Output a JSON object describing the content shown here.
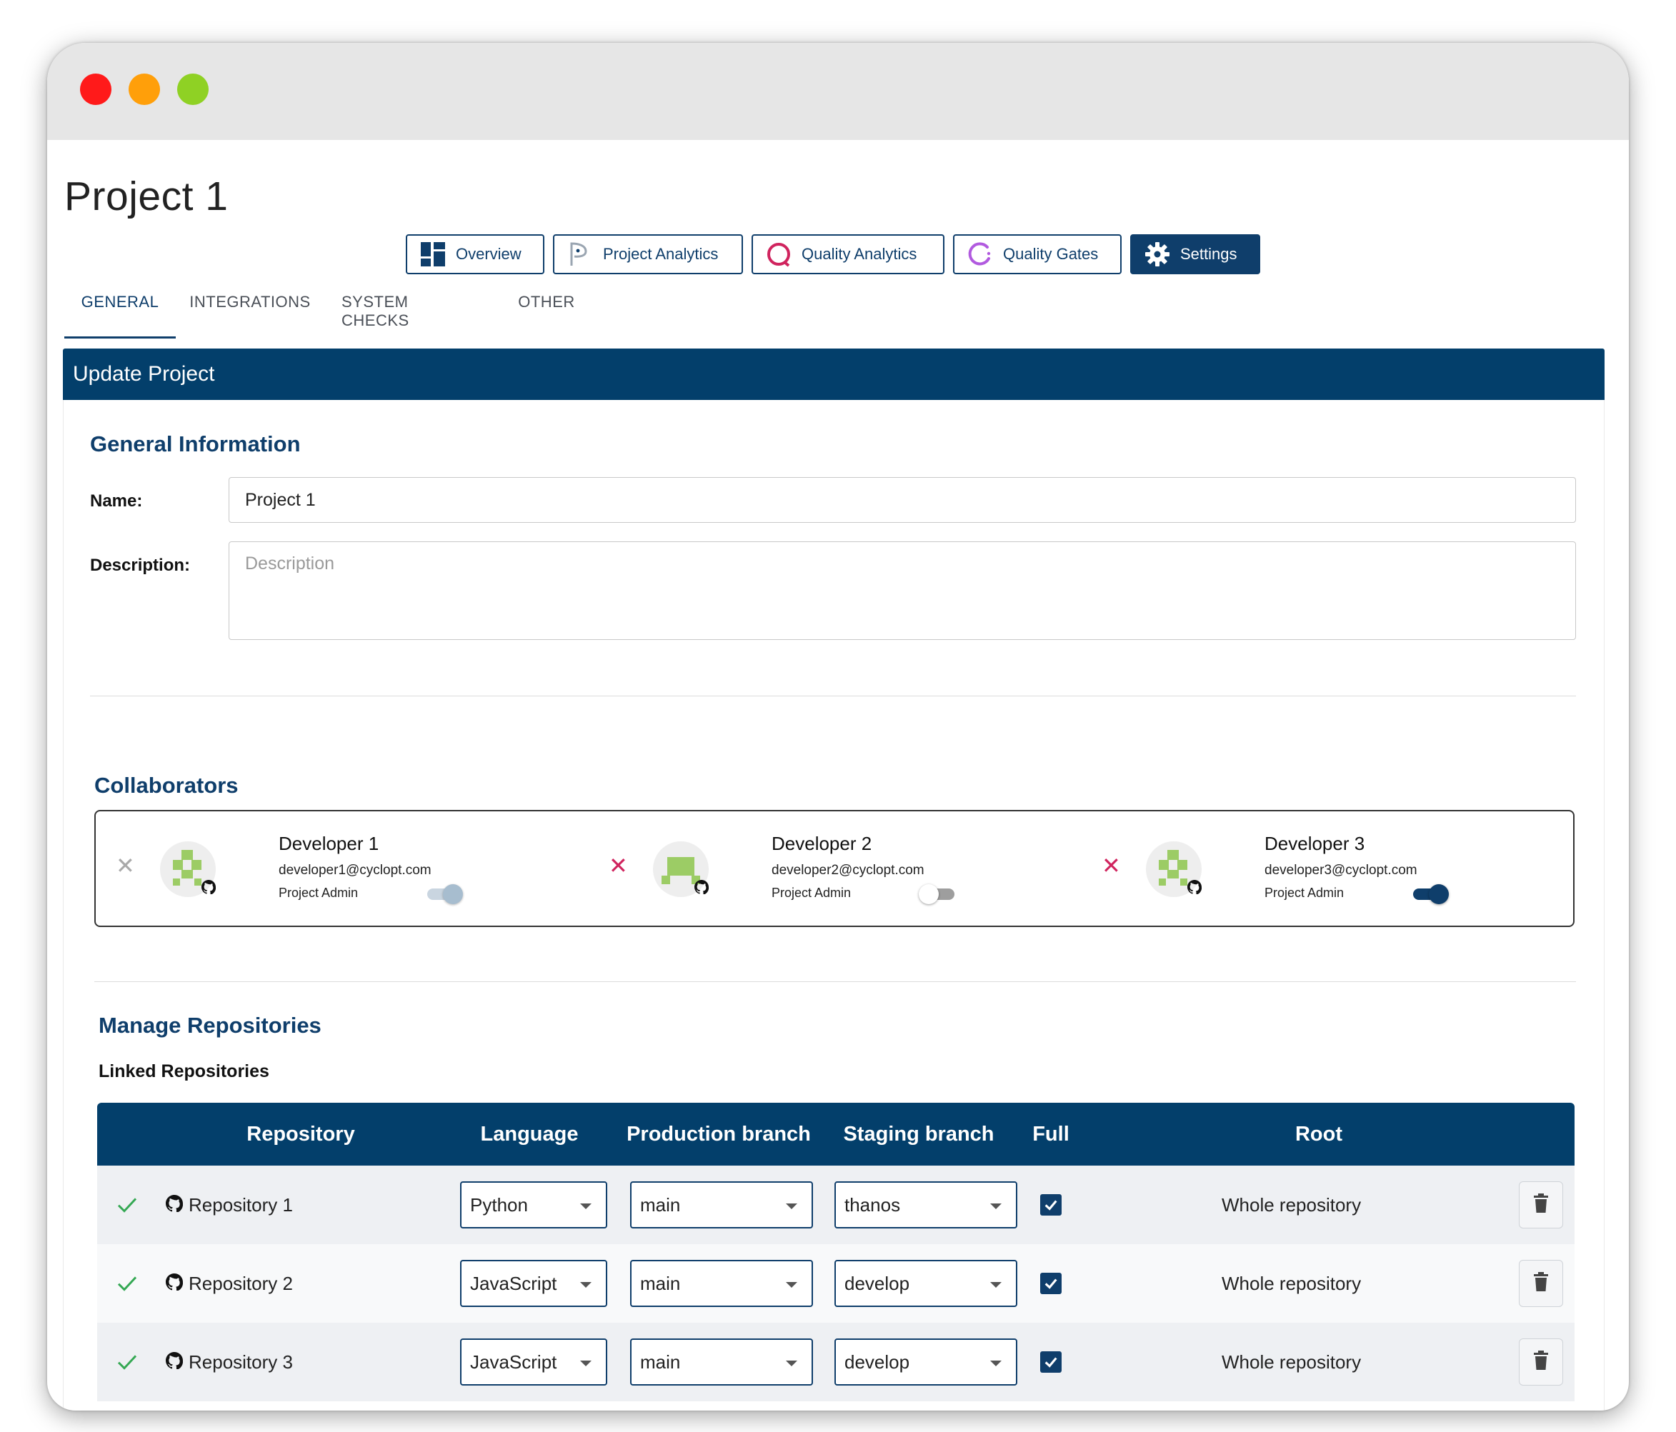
{
  "page": {
    "title": "Project 1"
  },
  "nav": {
    "overview": "Overview",
    "project_analytics": "Project Analytics",
    "quality_analytics": "Quality Analytics",
    "quality_gates": "Quality Gates",
    "settings": "Settings"
  },
  "tabs": {
    "general": "GENERAL",
    "integrations": "INTEGRATIONS",
    "system_checks": "SYSTEM CHECKS",
    "other": "OTHER"
  },
  "panel": {
    "header": "Update Project"
  },
  "general": {
    "title": "General Information",
    "name_label": "Name:",
    "name_value": "Project 1",
    "description_label": "Description:",
    "description_placeholder": "Description"
  },
  "collaborators": {
    "title": "Collaborators",
    "items": [
      {
        "name": "Developer 1",
        "email": "developer1@cyclopt.com",
        "role": "Project Admin",
        "admin_on": true,
        "toggle_enabled": false
      },
      {
        "name": "Developer 2",
        "email": "developer2@cyclopt.com",
        "role": "Project Admin",
        "admin_on": false,
        "toggle_enabled": true
      },
      {
        "name": "Developer 3",
        "email": "developer3@cyclopt.com",
        "role": "Project Admin",
        "admin_on": true,
        "toggle_enabled": true
      }
    ]
  },
  "repositories": {
    "title": "Manage Repositories",
    "subtitle": "Linked Repositories",
    "columns": {
      "repository": "Repository",
      "language": "Language",
      "production": "Production branch",
      "staging": "Staging branch",
      "full": "Full",
      "root": "Root"
    },
    "rows": [
      {
        "name": "Repository 1",
        "language": "Python",
        "production": "main",
        "staging": "thanos",
        "full": true,
        "root": "Whole repository"
      },
      {
        "name": "Repository 2",
        "language": "JavaScript",
        "production": "main",
        "staging": "develop",
        "full": true,
        "root": "Whole repository"
      },
      {
        "name": "Repository 3",
        "language": "JavaScript",
        "production": "main",
        "staging": "develop",
        "full": true,
        "root": "Whole repository"
      }
    ]
  },
  "colors": {
    "brand": "#0f3e6b",
    "header_bg": "#033f6b",
    "remove_active": "#d0245e",
    "remove_disabled": "#a9a9a9",
    "success": "#34a853",
    "avatar_green": "#9ccc65"
  },
  "icons": {
    "overview": "dashboard-icon",
    "project_analytics": "flag-icon",
    "quality_analytics": "ring-icon",
    "quality_gates": "gate-arc-icon",
    "settings": "gear-icon",
    "remove": "close-icon",
    "provider": "github-icon",
    "linked": "check-icon",
    "delete": "trash-icon"
  }
}
